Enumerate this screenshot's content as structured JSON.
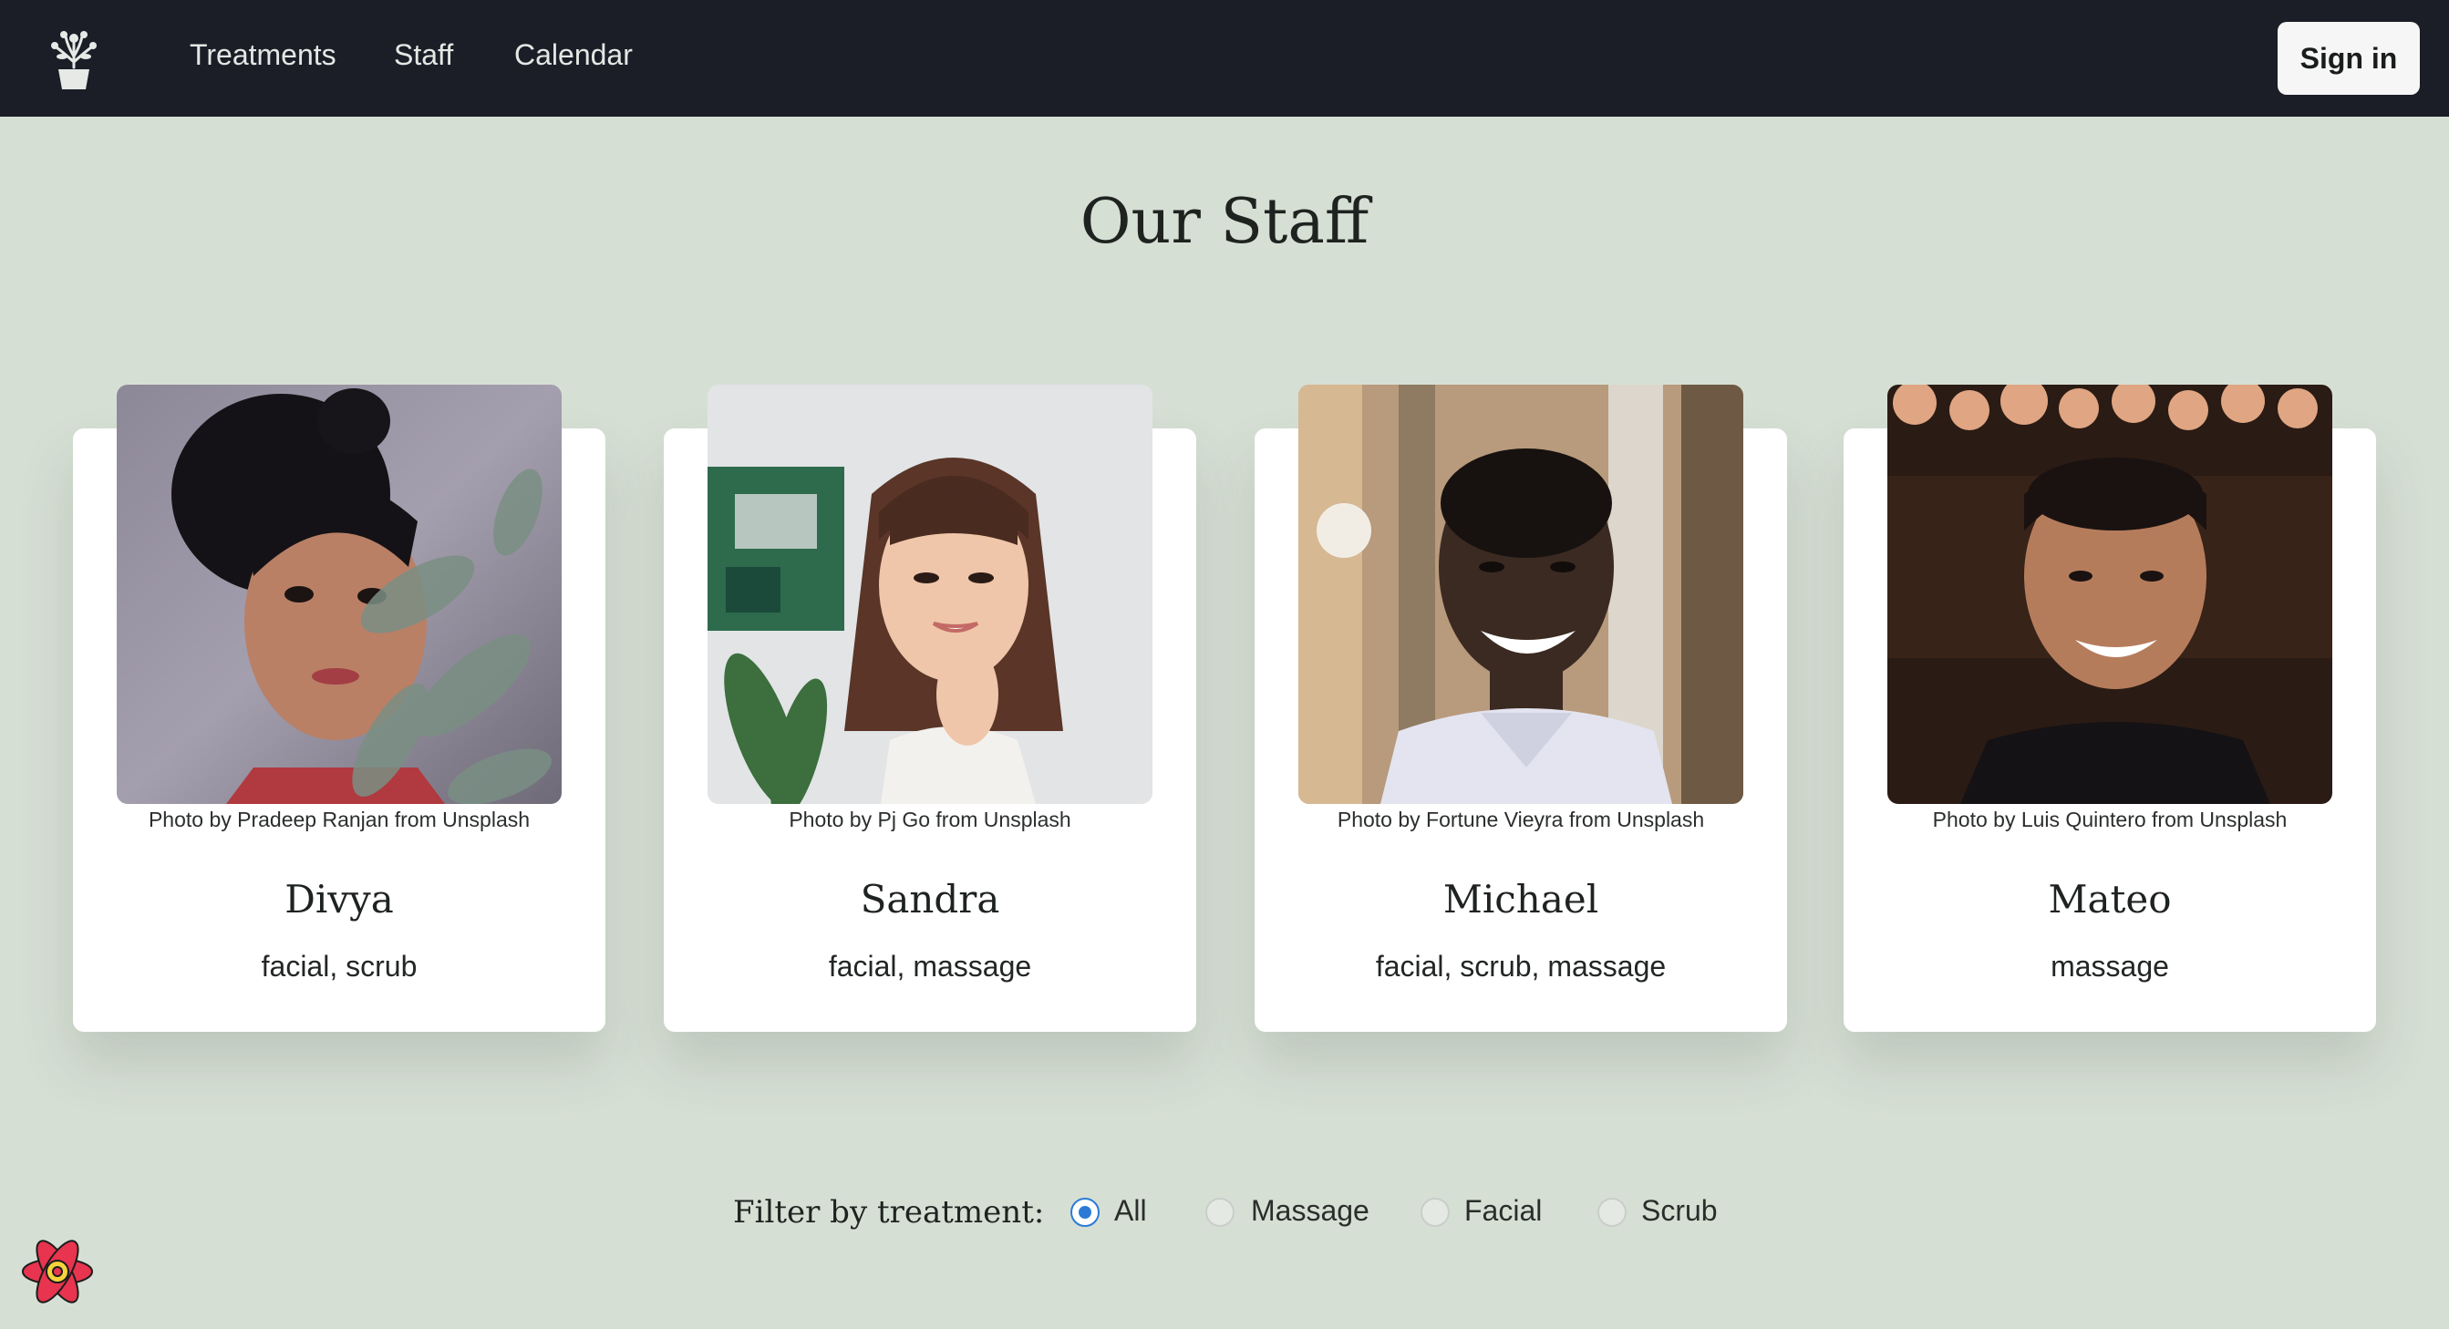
{
  "nav": {
    "logo_icon": "flower-pot-icon",
    "links": [
      "Treatments",
      "Staff",
      "Calendar"
    ],
    "signin_label": "Sign in"
  },
  "page": {
    "title": "Our Staff"
  },
  "staff": [
    {
      "credit": "Photo by Pradeep Ranjan from Unsplash",
      "name": "Divya",
      "treatments": "facial, scrub"
    },
    {
      "credit": "Photo by Pj Go from Unsplash",
      "name": "Sandra",
      "treatments": "facial, massage"
    },
    {
      "credit": "Photo by Fortune Vieyra from Unsplash",
      "name": "Michael",
      "treatments": "facial, scrub, massage"
    },
    {
      "credit": "Photo by Luis Quintero from Unsplash",
      "name": "Mateo",
      "treatments": "massage"
    }
  ],
  "filter": {
    "label": "Filter by treatment:",
    "options": [
      "All",
      "Massage",
      "Facial",
      "Scrub"
    ],
    "selected": "All"
  },
  "devtools_icon": "react-devtools-icon",
  "colors": {
    "nav_bg": "#1b1e27",
    "page_bg": "#d6dfd4",
    "card_bg": "#ffffff",
    "radio_accent": "#2b7bd6"
  }
}
